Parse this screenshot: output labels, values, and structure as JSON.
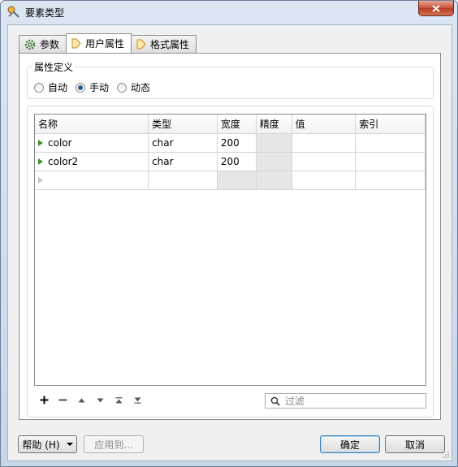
{
  "window": {
    "title": "要素类型",
    "close_icon": "close-icon"
  },
  "tabs": [
    {
      "label": "参数",
      "icon": "gear-icon",
      "active": false
    },
    {
      "label": "用户属性",
      "icon": "arrow-right-icon",
      "active": true
    },
    {
      "label": "格式属性",
      "icon": "arrow-right-icon",
      "active": false
    }
  ],
  "attr_def": {
    "legend": "属性定义",
    "options": [
      {
        "label": "自动",
        "checked": false
      },
      {
        "label": "手动",
        "checked": true
      },
      {
        "label": "动态",
        "checked": false
      }
    ]
  },
  "table": {
    "columns": [
      "名称",
      "类型",
      "宽度",
      "精度",
      "值",
      "索引"
    ],
    "rows": [
      {
        "name": "color",
        "type": "char",
        "width": "200",
        "precision": "",
        "value": "",
        "index": ""
      },
      {
        "name": "color2",
        "type": "char",
        "width": "200",
        "precision": "",
        "value": "",
        "index": ""
      }
    ]
  },
  "toolbar": {
    "icons": [
      "add-icon",
      "remove-icon",
      "move-up-icon",
      "move-down-icon",
      "move-top-icon",
      "move-bottom-icon"
    ],
    "filter_placeholder": "过滤"
  },
  "buttons": {
    "help": "帮助 (H)",
    "apply": "应用到...",
    "ok": "确定",
    "cancel": "取消"
  }
}
